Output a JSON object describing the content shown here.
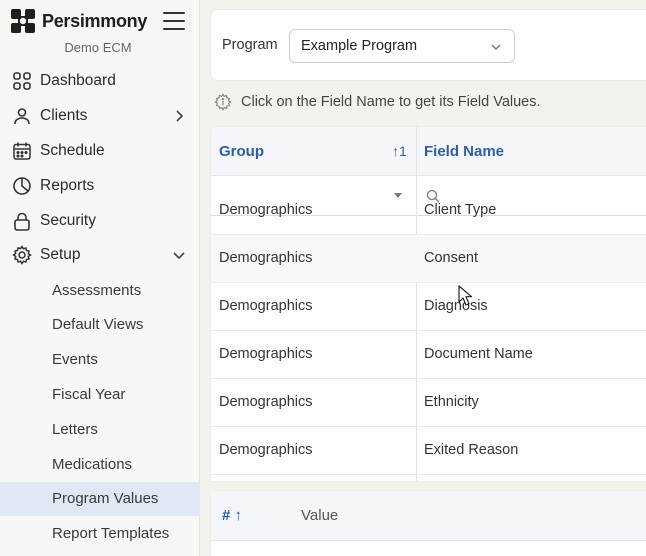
{
  "brand": {
    "name": "Persimmony",
    "org": "Demo ECM"
  },
  "nav": {
    "dashboard": "Dashboard",
    "clients": "Clients",
    "schedule": "Schedule",
    "reports": "Reports",
    "security": "Security",
    "setup": "Setup"
  },
  "setup_items": [
    "Assessments",
    "Default Views",
    "Events",
    "Fiscal Year",
    "Letters",
    "Medications",
    "Program Values",
    "Report Templates"
  ],
  "active_setup_item": "Program Values",
  "program": {
    "label": "Program",
    "selected": "Example Program"
  },
  "hint": "Click on the Field Name to get its Field Values.",
  "grid": {
    "columns": {
      "group": "Group",
      "field_name": "Field Name"
    },
    "sort": "↑1",
    "rows": [
      {
        "group": "Demographics",
        "field": "Client Type"
      },
      {
        "group": "Demographics",
        "field": "Consent"
      },
      {
        "group": "Demographics",
        "field": "Diagnosis"
      },
      {
        "group": "Demographics",
        "field": "Document Name"
      },
      {
        "group": "Demographics",
        "field": "Ethnicity"
      },
      {
        "group": "Demographics",
        "field": "Exited Reason"
      }
    ]
  },
  "values_grid": {
    "num_header": "# ↑",
    "value_header": "Value"
  }
}
